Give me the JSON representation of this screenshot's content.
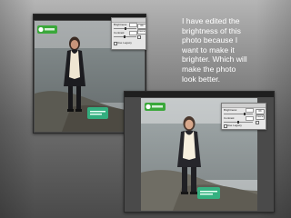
{
  "caption": "I have edited the\nbrightness of this\nphoto because I\nwant to make it\nbrighter. Which will\nmake the photo\nlook better.",
  "editor_before": {
    "window_title": "",
    "dialog": {
      "brightness_label": "Brightness:",
      "contrast_label": "Contrast:",
      "use_legacy_label": "Use Legacy",
      "ok_label": "OK",
      "cancel_label": "Cancel",
      "preview_label": "Preview"
    }
  },
  "editor_after": {
    "window_title": "",
    "dialog": {
      "brightness_label": "Brightness:",
      "contrast_label": "Contrast:",
      "use_legacy_label": "Use Legacy",
      "ok_label": "OK",
      "cancel_label": "Cancel",
      "preview_label": "Preview"
    }
  },
  "colors": {
    "badge_green": "#3aa83a",
    "watermark_green": "#2fbf8a",
    "coat": "#1c1c20",
    "scarf": "#efe6d2"
  },
  "icons": [
    "zone-logo-badge",
    "watermark-logo"
  ]
}
